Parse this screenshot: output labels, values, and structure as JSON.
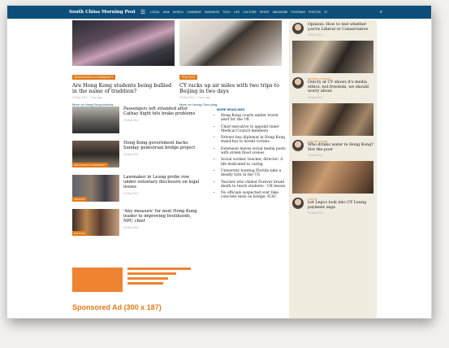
{
  "topbar": {
    "brand": "South China Morning Post",
    "nav": [
      "LOCAL",
      "ASIA",
      "WORLD",
      "COMMENT",
      "BUSINESS",
      "TECH",
      "LIFE",
      "CULTURE",
      "SPORT",
      "MAGAZINE",
      "POSTMAG",
      "PHOTOS",
      "TV"
    ]
  },
  "featured": [
    {
      "tag": "EDUCATION & COMMUNITY",
      "headline": "Are Hong Kong students being bullied in the name of tradition?",
      "meta": "30 May 2014 · 1 hour ago",
      "more": "More on Hong Kong schools"
    },
    {
      "tag": "POLITICS",
      "headline": "CY racks up air miles with two trips to Beijing in two days",
      "meta": "30 May 2014 · 2 hours ago",
      "more": "More on Leung Chun-ying"
    }
  ],
  "stories": [
    {
      "tag": "",
      "headline": "Passengers left stranded after Cathay flight hits brake problems",
      "meta": "30 May 2014"
    },
    {
      "tag": "EDUCATION & COMMUNITY",
      "headline": "Hong Kong government backs Sunday pedestrian bridge project",
      "meta": "30 May 2014"
    },
    {
      "tag": "POLITICS",
      "headline": "Lawmaker in Leung probe row under voluntary disclosure on legal issues",
      "meta": "30 May 2014"
    },
    {
      "tag": "POLITICS",
      "headline": "'Any measure' for next Hong Kong leader to improving livelihoods, NPC chief",
      "meta": "30 May 2014"
    }
  ],
  "headlines": {
    "title": "MORE HEADLINES",
    "items": [
      "Hong Kong courts amber travel alert for the UK",
      "Chief executive to appoint Inner Medical Council members",
      "Drivers buy diplomat in Hong Kong stand-bys to invent victims",
      "Extension leaves social media posts with stolen flood scenes",
      "Social worker, teacher, director: A life dedicated to caring",
      "University hunting Florida take a deadly turn in the US",
      "Teacher who chided Forever brand death to teach students - UK lesson",
      "No officials suspected over fake concrete tests on bridge: ICAC"
    ]
  },
  "ad": {
    "label": "Sponsored Ad (300 x 187)"
  },
  "sidebar": [
    {
      "label": "",
      "headline": "Opinion: How to test whether you're Liberal or Conservative",
      "meta": "30 May 2014"
    },
    {
      "label": "NATIONAL OPINION",
      "headline": "Outcry at CY shows it's media ethics, not freedom, we should worry about",
      "meta": "30 May 2014"
    },
    {
      "label": "LIVE AND LEARN",
      "headline": "Who drinks water in Hong Kong? Not the poor",
      "meta": "30 May 2014"
    },
    {
      "label": "JUST IN",
      "headline": "Let Legco look into CY Leung payment saga",
      "meta": "30 May 2014"
    }
  ]
}
